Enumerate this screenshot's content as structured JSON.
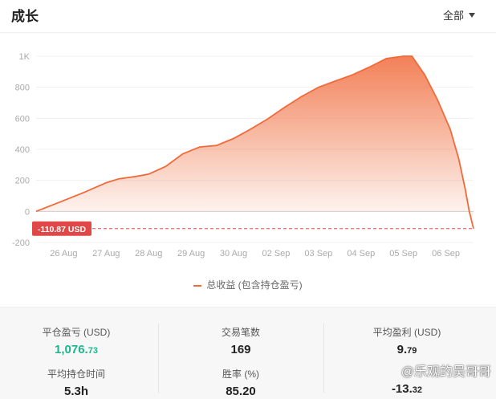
{
  "header": {
    "title": "成长",
    "filter_label": "全部"
  },
  "chart_data": {
    "type": "area",
    "xlabel": "",
    "ylabel": "",
    "ylim": [
      -200,
      1000
    ],
    "y_ticks": [
      1000,
      800,
      600,
      400,
      200,
      0,
      -200
    ],
    "y_tick_labels": [
      "1K",
      "800",
      "600",
      "400",
      "200",
      "0",
      "-200"
    ],
    "x_tick_labels": [
      "26 Aug",
      "27 Aug",
      "28 Aug",
      "29 Aug",
      "30 Aug",
      "02 Sep",
      "03 Sep",
      "04 Sep",
      "05 Sep",
      "06 Sep"
    ],
    "x_range": [
      -0.65,
      9.65
    ],
    "series": [
      {
        "name": "总收益 (包含持仓盈亏)",
        "x": [
          -0.65,
          0.0,
          0.5,
          1.0,
          1.3,
          1.7,
          2.0,
          2.4,
          2.8,
          3.2,
          3.6,
          4.0,
          4.4,
          4.8,
          5.2,
          5.6,
          6.0,
          6.4,
          6.8,
          7.2,
          7.6,
          8.0,
          8.2,
          8.3,
          8.5,
          8.8,
          9.1,
          9.3,
          9.45,
          9.55,
          9.65
        ],
        "y": [
          0,
          70,
          125,
          185,
          210,
          225,
          240,
          290,
          370,
          415,
          425,
          470,
          530,
          595,
          670,
          740,
          800,
          840,
          880,
          930,
          985,
          1000,
          1000,
          960,
          880,
          720,
          530,
          340,
          150,
          0,
          -110.87
        ]
      }
    ],
    "final_value": -110.87,
    "final_value_label": "-110.87 USD",
    "line_color": "#f06a3a",
    "badge_color": "#e04848",
    "grid": true,
    "legend_position": "bottom"
  },
  "legend": {
    "label": "总收益 (包含持仓盈亏)"
  },
  "stats": {
    "closed_pnl": {
      "label": "平仓盈亏 (USD)",
      "int": "1,076.",
      "dec": "73"
    },
    "trade_count": {
      "label": "交易笔数",
      "value": "169"
    },
    "avg_profit": {
      "label": "平均盈利 (USD)",
      "int": "9.",
      "dec": "79"
    },
    "avg_hold": {
      "label": "平均持仓时间",
      "value": "5.3h"
    },
    "win_rate": {
      "label": "胜率 (%)",
      "value": "85.20"
    },
    "avg_loss": {
      "int": "-13.",
      "dec": "32"
    }
  },
  "watermark": "@乐观的吴哥哥",
  "colors": {
    "positive": "#1fb38e",
    "accent": "#f06a3a"
  }
}
